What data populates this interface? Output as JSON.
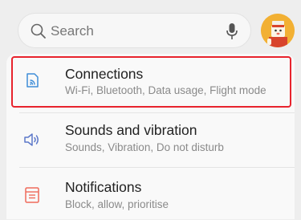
{
  "search": {
    "placeholder": "Search",
    "icon": "search-icon",
    "voice_icon": "mic-icon"
  },
  "profile": {
    "icon": "avatar"
  },
  "settings": {
    "items": [
      {
        "title": "Connections",
        "subtitle": "Wi-Fi, Bluetooth, Data usage, Flight mode",
        "icon": "connections-icon",
        "icon_color": "#3f8ed8",
        "highlighted": true
      },
      {
        "title": "Sounds and vibration",
        "subtitle": "Sounds, Vibration, Do not disturb",
        "icon": "speaker-icon",
        "icon_color": "#5c78c9"
      },
      {
        "title": "Notifications",
        "subtitle": "Block, allow, prioritise",
        "icon": "notifications-icon",
        "icon_color": "#ef6a5a"
      }
    ]
  },
  "colors": {
    "highlight_border": "#e8232d",
    "background": "#eeeeee",
    "card": "#f9f9f9"
  }
}
